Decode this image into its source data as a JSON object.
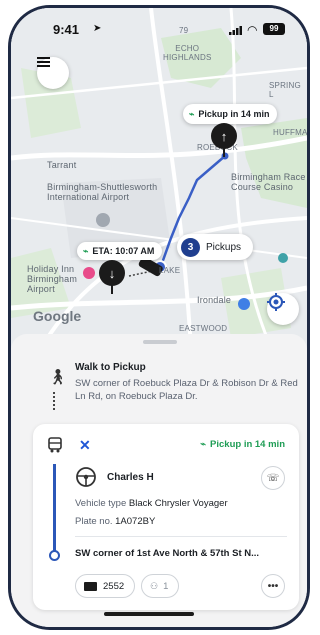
{
  "status_bar": {
    "time": "9:41",
    "battery": "99"
  },
  "map": {
    "labels": {
      "echo_highlands": "ECHO\nHIGHLANDS",
      "huffman": "HUFFMAN",
      "roebuck": "ROEBUCK",
      "tarrant": "Tarrant",
      "airport": "Birmingham-Shuttlesworth\nInternational Airport",
      "race_course": "Birmingham Race\nCourse Casino",
      "holiday_inn": "Holiday Inn\nBirmingham\nAirport",
      "irondale": "Irondale",
      "eastwood": "EASTWOOD",
      "lake": "LAKE",
      "spring_lake": "SPRING L",
      "route_79": "79"
    },
    "pickup_pill": "Pickup in 14 min",
    "eta_pill": "ETA: 10:07 AM",
    "pickups_count": "3",
    "pickups_label": "Pickups",
    "google_logo": "Google",
    "colors": {
      "route": "#3a5fc6",
      "accent": "#1f3e8f",
      "green": "#1f9d55"
    }
  },
  "sheet": {
    "walk_title": "Walk to Pickup",
    "walk_desc": "SW corner of Roebuck Plaza Dr & Robison Dr & Red Ln Rd, on Roebuck Plaza Dr.",
    "trip": {
      "pickup_status": "Pickup in 14 min",
      "driver_name": "Charles H",
      "vehicle_type_label": "Vehicle type",
      "vehicle_type": "Black Chrysler Voyager",
      "plate_label": "Plate no.",
      "plate": "1A072BY",
      "destination": "SW corner of 1st Ave North & 57th St N...",
      "payment": "2552",
      "passengers": "1"
    }
  },
  "icons": [
    "menu-icon",
    "location-arrow-icon",
    "signal-icon",
    "wifi-icon",
    "battery-icon",
    "arrow-up-icon",
    "arrow-down-icon",
    "recenter-icon",
    "walk-icon",
    "bus-icon",
    "steering-wheel-icon",
    "phone-icon",
    "card-icon",
    "passenger-icon",
    "more-icon"
  ]
}
